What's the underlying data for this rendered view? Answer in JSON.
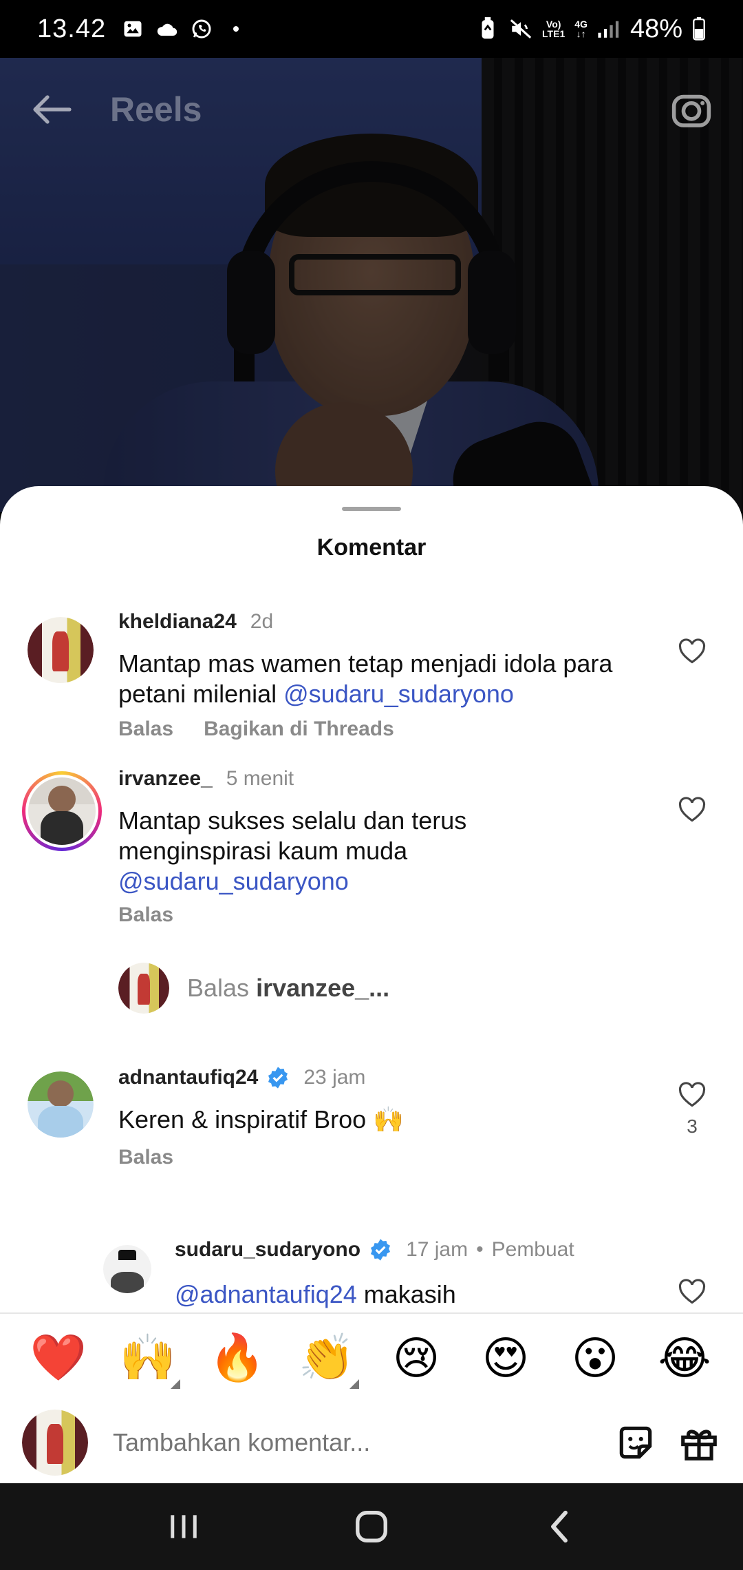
{
  "status_bar": {
    "time": "13.42",
    "network_top": "Vo)",
    "network_bottom": "LTE1",
    "net_type_top": "4G",
    "battery": "48%"
  },
  "header": {
    "title": "Reels"
  },
  "sheet": {
    "title": "Komentar"
  },
  "comments": [
    {
      "username": "kheldiana24",
      "time": "2d",
      "text": "Mantap mas wamen tetap menjadi idola para petani milenial ",
      "mention": "@sudaru_sudaryono",
      "reply_label": "Balas",
      "share_label": "Bagikan di Threads"
    },
    {
      "username": "irvanzee_",
      "time": "5 menit",
      "text": "Mantap sukses selalu dan terus menginspirasi kaum muda",
      "mention": "@sudaru_sudaryono",
      "reply_label": "Balas"
    },
    {
      "username": "adnantaufiq24",
      "time": "23 jam",
      "text": "Keren & inspiratif Broo 🙌",
      "reply_label": "Balas",
      "likes": "3"
    },
    {
      "username": "sudaru_sudaryono",
      "time": "17 jam",
      "creator_label": "Pembuat",
      "mention": "@adnantaufiq24",
      "text": " makasih"
    }
  ],
  "reply_prompt": {
    "prefix": "Balas ",
    "username": "irvanzee_..."
  },
  "emoji_bar": [
    "❤️",
    "🙌",
    "🔥",
    "👏",
    "😢",
    "😍",
    "😮",
    "😂"
  ],
  "compose": {
    "placeholder": "Tambahkan komentar..."
  },
  "colors": {
    "mention": "#3b56c4",
    "verified": "#3897f0",
    "sheet_bg": "#ffffff",
    "nav_bg": "#141414"
  }
}
